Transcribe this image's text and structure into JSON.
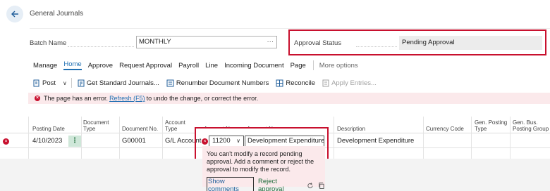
{
  "header": {
    "title": "General Journals",
    "back_icon": "arrow-left-icon"
  },
  "batch": {
    "label": "Batch Name",
    "value": "MONTHLY",
    "lookup": "···"
  },
  "approval": {
    "label": "Approval Status",
    "value": "Pending Approval"
  },
  "tabs": [
    {
      "label": "Manage",
      "active": false
    },
    {
      "label": "Home",
      "active": true
    },
    {
      "label": "Approve",
      "active": false
    },
    {
      "label": "Request Approval",
      "active": false
    },
    {
      "label": "Payroll",
      "active": false
    },
    {
      "label": "Line",
      "active": false
    },
    {
      "label": "Incoming Document",
      "active": false
    },
    {
      "label": "Page",
      "active": false
    }
  ],
  "more_options": "More options",
  "toolbar": {
    "post": "Post",
    "chevron": "∨",
    "get_standard": "Get Standard Journals...",
    "renumber": "Renumber Document Numbers",
    "reconcile": "Reconcile",
    "apply_entries": "Apply Entries..."
  },
  "error_bar": {
    "text_before": "The page has an error.",
    "link": "Refresh (F5)",
    "text_after": "to undo the change, or correct the error."
  },
  "columns": {
    "posting_date": [
      "Posting Date"
    ],
    "document_type": [
      "Document",
      "Type"
    ],
    "document_no": [
      "Document No."
    ],
    "account_type": [
      "Account",
      "Type"
    ],
    "account_no": [
      "Account No."
    ],
    "account_name": [
      "Account Name"
    ],
    "description": [
      "Description"
    ],
    "currency_code": [
      "Currency Code"
    ],
    "gen_posting_type": [
      "Gen. Posting",
      "Type"
    ],
    "gen_bus_posting_group": [
      "Gen. Bus.",
      "Posting Group"
    ]
  },
  "row": {
    "posting_date": "4/10/2023",
    "kebab": "⋮",
    "document_no": "G00001",
    "account_type": "G/L Account",
    "account_no": "11200",
    "account_no_chevron": "∨",
    "account_name": "Development Expenditure",
    "description": "Development Expenditure"
  },
  "popup": {
    "message": "You can't modify a record pending approval. Add a comment or reject the approval to modify the record.",
    "show_comments": "Show comments",
    "reject_approval": "Reject approval"
  },
  "colors": {
    "accent": "#1f6fb2",
    "error": "#c8102e",
    "error_bg": "#fbe9eb"
  }
}
